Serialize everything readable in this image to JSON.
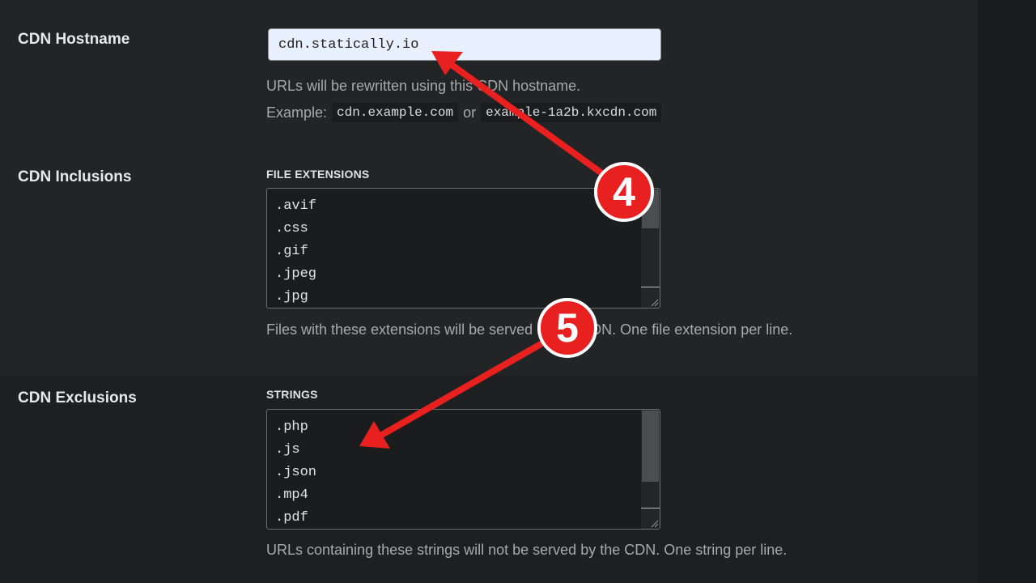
{
  "hostname": {
    "label": "CDN Hostname",
    "value": "cdn.statically.io",
    "description": "URLs will be rewritten using this CDN hostname.",
    "example_prefix": "Example:",
    "example_code_1": "cdn.example.com",
    "example_or": "or",
    "example_code_2": "example-1a2b.kxcdn.com"
  },
  "inclusions": {
    "label": "CDN Inclusions",
    "sublabel": "FILE EXTENSIONS",
    "lines": [
      ".avif",
      ".css",
      ".gif",
      ".jpeg",
      ".jpg"
    ],
    "description": "Files with these extensions will be served by the CDN. One file extension per line."
  },
  "exclusions": {
    "label": "CDN Exclusions",
    "sublabel": "STRINGS",
    "lines": [
      ".php",
      ".js",
      ".json",
      ".mp4",
      ".pdf"
    ],
    "description": "URLs containing these strings will not be served by the CDN. One string per line."
  },
  "annotations": {
    "badge_4": "4",
    "badge_5": "5",
    "arrow_color": "#e8201f"
  }
}
